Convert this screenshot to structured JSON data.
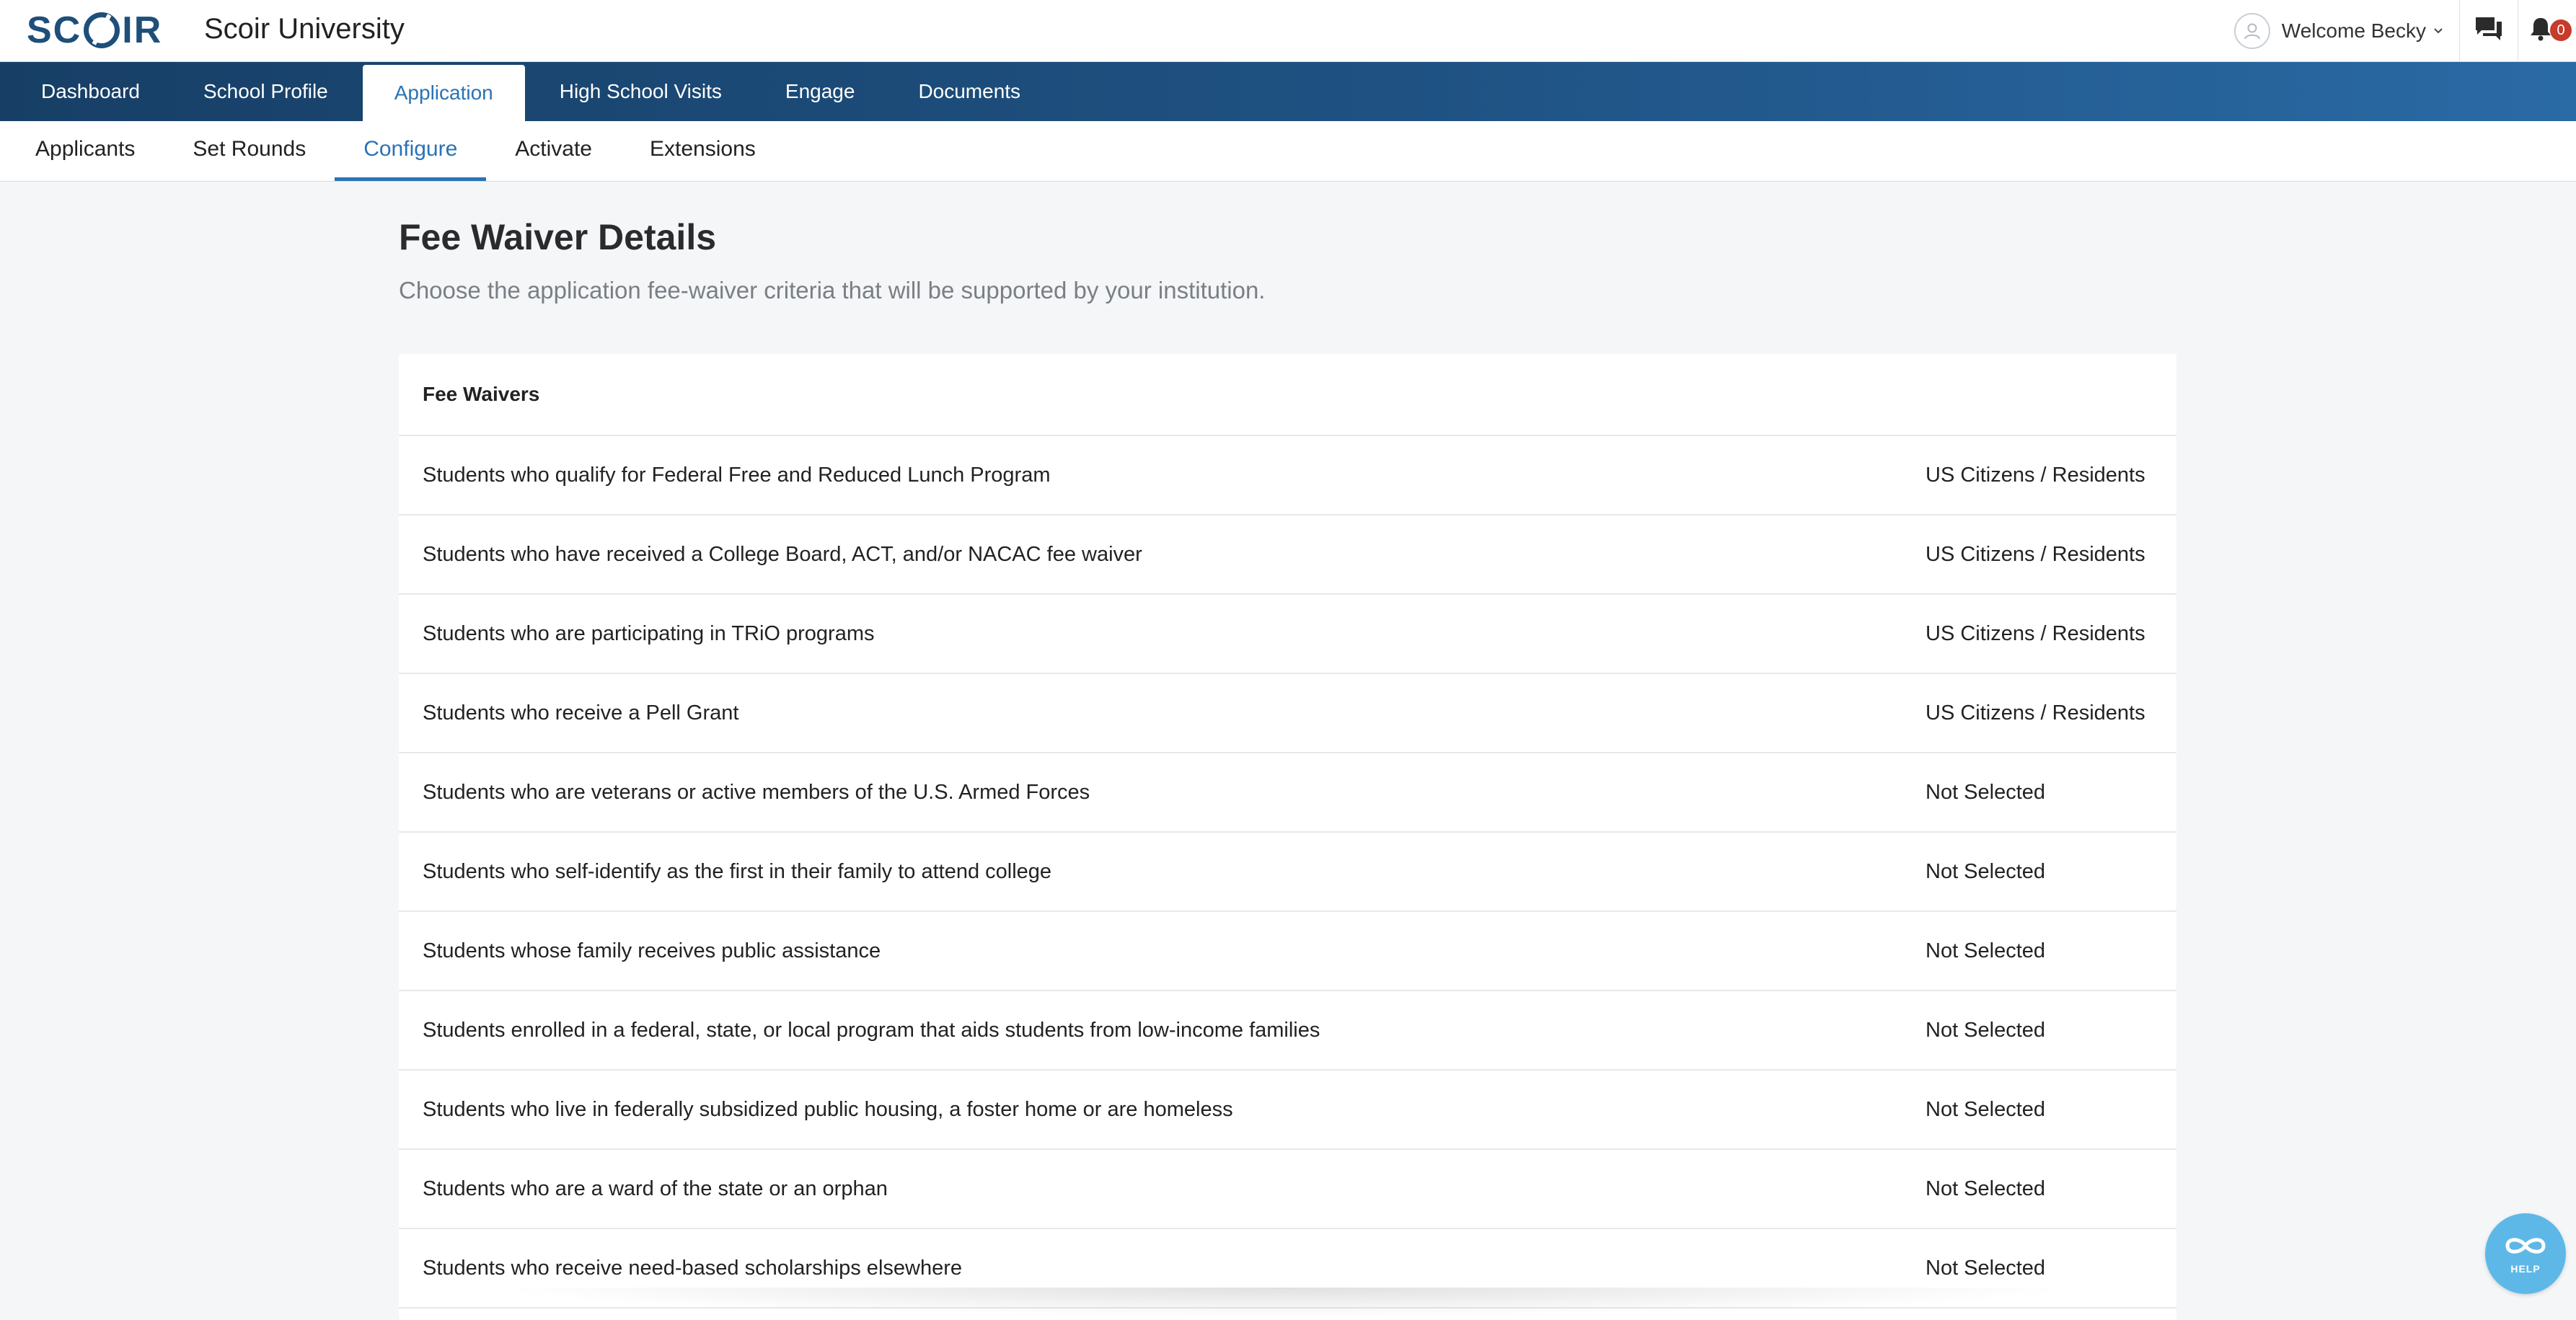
{
  "header": {
    "logo_text": "SCOIR",
    "institution_name": "Scoir University",
    "welcome_text": "Welcome Becky",
    "notification_count": "0"
  },
  "primary_nav": {
    "items": [
      {
        "label": "Dashboard"
      },
      {
        "label": "School Profile"
      },
      {
        "label": "Application",
        "active": true
      },
      {
        "label": "High School Visits"
      },
      {
        "label": "Engage"
      },
      {
        "label": "Documents"
      }
    ]
  },
  "secondary_nav": {
    "items": [
      {
        "label": "Applicants"
      },
      {
        "label": "Set Rounds"
      },
      {
        "label": "Configure",
        "active": true
      },
      {
        "label": "Activate"
      },
      {
        "label": "Extensions"
      }
    ]
  },
  "main": {
    "title": "Fee Waiver Details",
    "subtitle": "Choose the application fee-waiver criteria that will be supported by your institution.",
    "card_header": "Fee Waivers",
    "waivers": [
      {
        "label": "Students who qualify for Federal Free and Reduced Lunch Program",
        "status": "US Citizens / Residents"
      },
      {
        "label": "Students who have received a College Board, ACT, and/or NACAC fee waiver",
        "status": "US Citizens / Residents"
      },
      {
        "label": "Students who are participating in TRiO programs",
        "status": "US Citizens / Residents"
      },
      {
        "label": "Students who receive a Pell Grant",
        "status": "US Citizens / Residents"
      },
      {
        "label": "Students who are veterans or active members of the U.S. Armed Forces",
        "status": "Not Selected"
      },
      {
        "label": "Students who self-identify as the first in their family to attend college",
        "status": "Not Selected"
      },
      {
        "label": "Students whose family receives public assistance",
        "status": "Not Selected"
      },
      {
        "label": "Students enrolled in a federal, state, or local program that aids students from low-income families",
        "status": "Not Selected"
      },
      {
        "label": "Students who live in federally subsidized public housing, a foster home or are homeless",
        "status": "Not Selected"
      },
      {
        "label": "Students who are a ward of the state or an orphan",
        "status": "Not Selected"
      },
      {
        "label": "Students who receive need-based scholarships elsewhere",
        "status": "Not Selected"
      }
    ]
  },
  "help": {
    "label": "HELP"
  },
  "colors": {
    "brand_navy": "#1e4f7a",
    "active_blue": "#2a72b5",
    "badge_red": "#c63b2b",
    "help_blue": "#5db8e8"
  }
}
